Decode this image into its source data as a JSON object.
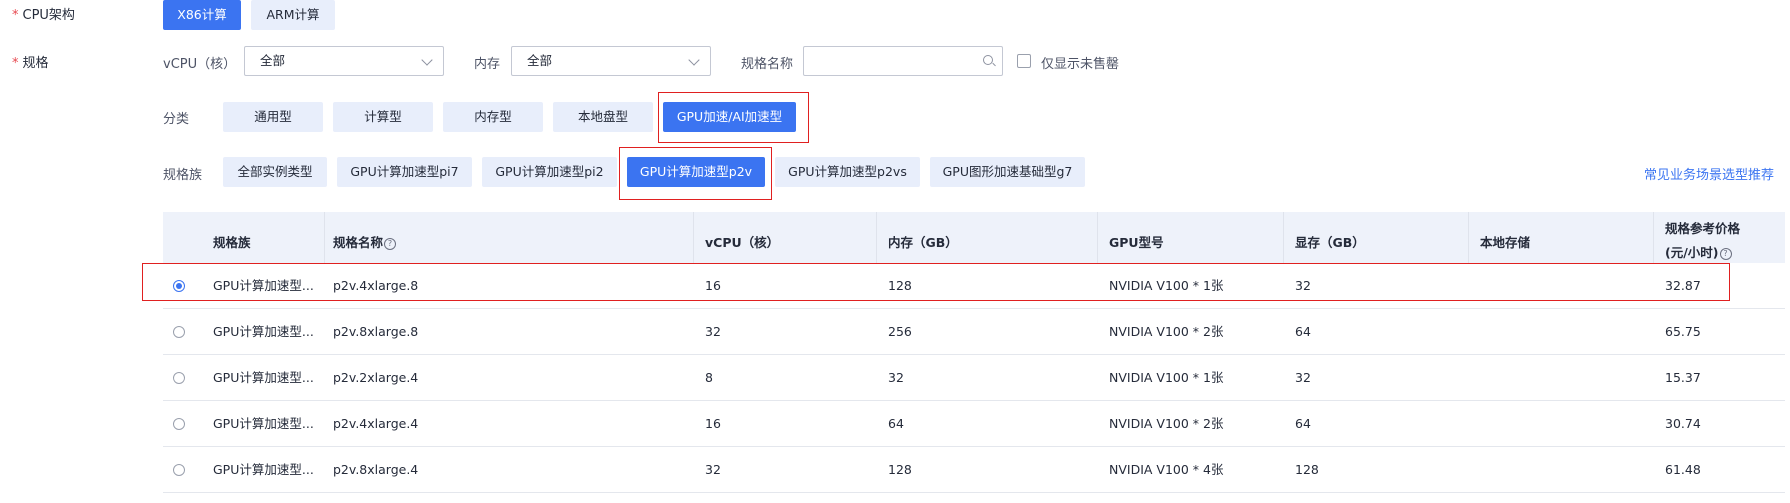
{
  "cpu_arch": {
    "required_mark": "*",
    "label": "CPU架构",
    "options": [
      "X86计算",
      "ARM计算"
    ],
    "selected": "X86计算"
  },
  "spec": {
    "required_mark": "*",
    "label": "规格",
    "vcpu_label": "vCPU（核）",
    "vcpu_value": "全部",
    "memory_label": "内存",
    "memory_value": "全部",
    "name_label": "规格名称",
    "name_value": "",
    "name_placeholder": "",
    "only_unsold_label": "仅显示未售罄"
  },
  "category": {
    "label": "分类",
    "options": [
      "通用型",
      "计算型",
      "内存型",
      "本地盘型",
      "GPU加速/AI加速型"
    ],
    "selected": "GPU加速/AI加速型"
  },
  "family": {
    "label": "规格族",
    "options": [
      "全部实例类型",
      "GPU计算加速型pi7",
      "GPU计算加速型pi2",
      "GPU计算加速型p2v",
      "GPU计算加速型p2vs",
      "GPU图形加速基础型g7"
    ],
    "selected": "GPU计算加速型p2v",
    "recommend_link": "常见业务场景选型推荐"
  },
  "table": {
    "headers": {
      "family": "规格族",
      "name": "规格名称",
      "vcpu": "vCPU（核）",
      "memory": "内存（GB）",
      "gpu_model": "GPU型号",
      "vram": "显存（GB）",
      "local_storage": "本地存储",
      "price_line1": "规格参考价格",
      "price_line2": "(元/小时)"
    },
    "help_glyph": "?",
    "rows": [
      {
        "selected": true,
        "family": "GPU计算加速型...",
        "name": "p2v.4xlarge.8",
        "vcpu": "16",
        "memory": "128",
        "gpu": "NVIDIA V100 * 1张",
        "vram": "32",
        "storage": "",
        "price": "32.87"
      },
      {
        "selected": false,
        "family": "GPU计算加速型...",
        "name": "p2v.8xlarge.8",
        "vcpu": "32",
        "memory": "256",
        "gpu": "NVIDIA V100 * 2张",
        "vram": "64",
        "storage": "",
        "price": "65.75"
      },
      {
        "selected": false,
        "family": "GPU计算加速型...",
        "name": "p2v.2xlarge.4",
        "vcpu": "8",
        "memory": "32",
        "gpu": "NVIDIA V100 * 1张",
        "vram": "32",
        "storage": "",
        "price": "15.37"
      },
      {
        "selected": false,
        "family": "GPU计算加速型...",
        "name": "p2v.4xlarge.4",
        "vcpu": "16",
        "memory": "64",
        "gpu": "NVIDIA V100 * 2张",
        "vram": "64",
        "storage": "",
        "price": "30.74"
      },
      {
        "selected": false,
        "family": "GPU计算加速型...",
        "name": "p2v.8xlarge.4",
        "vcpu": "32",
        "memory": "128",
        "gpu": "NVIDIA V100 * 4张",
        "vram": "128",
        "storage": "",
        "price": "61.48"
      }
    ]
  },
  "colors": {
    "accent": "#3b74f1",
    "highlight_box": "#e02020",
    "header_bg": "#eef2fa",
    "button_bg": "#e8eefb"
  }
}
